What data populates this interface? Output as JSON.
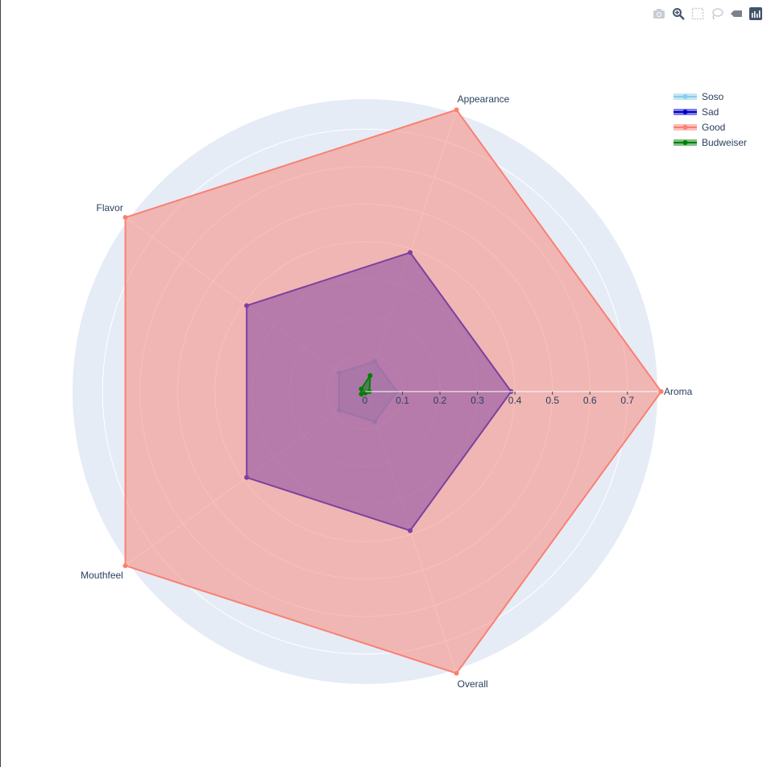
{
  "toolbar": {
    "buttons": [
      {
        "name": "camera-icon",
        "active": false
      },
      {
        "name": "zoom-icon",
        "active": true
      },
      {
        "name": "box-select-icon",
        "active": false
      },
      {
        "name": "lasso-select-icon",
        "active": false
      },
      {
        "name": "compare-hover-icon",
        "active": false
      },
      {
        "name": "plotly-logo-icon",
        "active": false
      }
    ]
  },
  "chart_data": {
    "type": "radar",
    "axes": [
      "Aroma",
      "Appearance",
      "Flavor",
      "Mouthfeel",
      "Overall"
    ],
    "radial_range": [
      0,
      0.78
    ],
    "radial_ticks": [
      0,
      0.1,
      0.2,
      0.3,
      0.4,
      0.5,
      0.6,
      0.7
    ],
    "angular_direction": "counterclockwise",
    "grid": true,
    "legend_position": "top-right",
    "background_color": "#e5ecf6",
    "series": [
      {
        "name": "Soso",
        "color": "#87ceeb",
        "values": [
          0.085,
          0.085,
          0.085,
          0.085,
          0.085
        ]
      },
      {
        "name": "Sad",
        "color": "#0000cd",
        "values": [
          0.39,
          0.39,
          0.39,
          0.39,
          0.39
        ]
      },
      {
        "name": "Good",
        "color": "#fa8072",
        "values": [
          0.79,
          0.79,
          0.79,
          0.79,
          0.79
        ]
      },
      {
        "name": "Budweiser",
        "color": "#008000",
        "values": [
          0.012,
          0.045,
          0.012,
          0.012,
          0.004
        ]
      }
    ]
  }
}
